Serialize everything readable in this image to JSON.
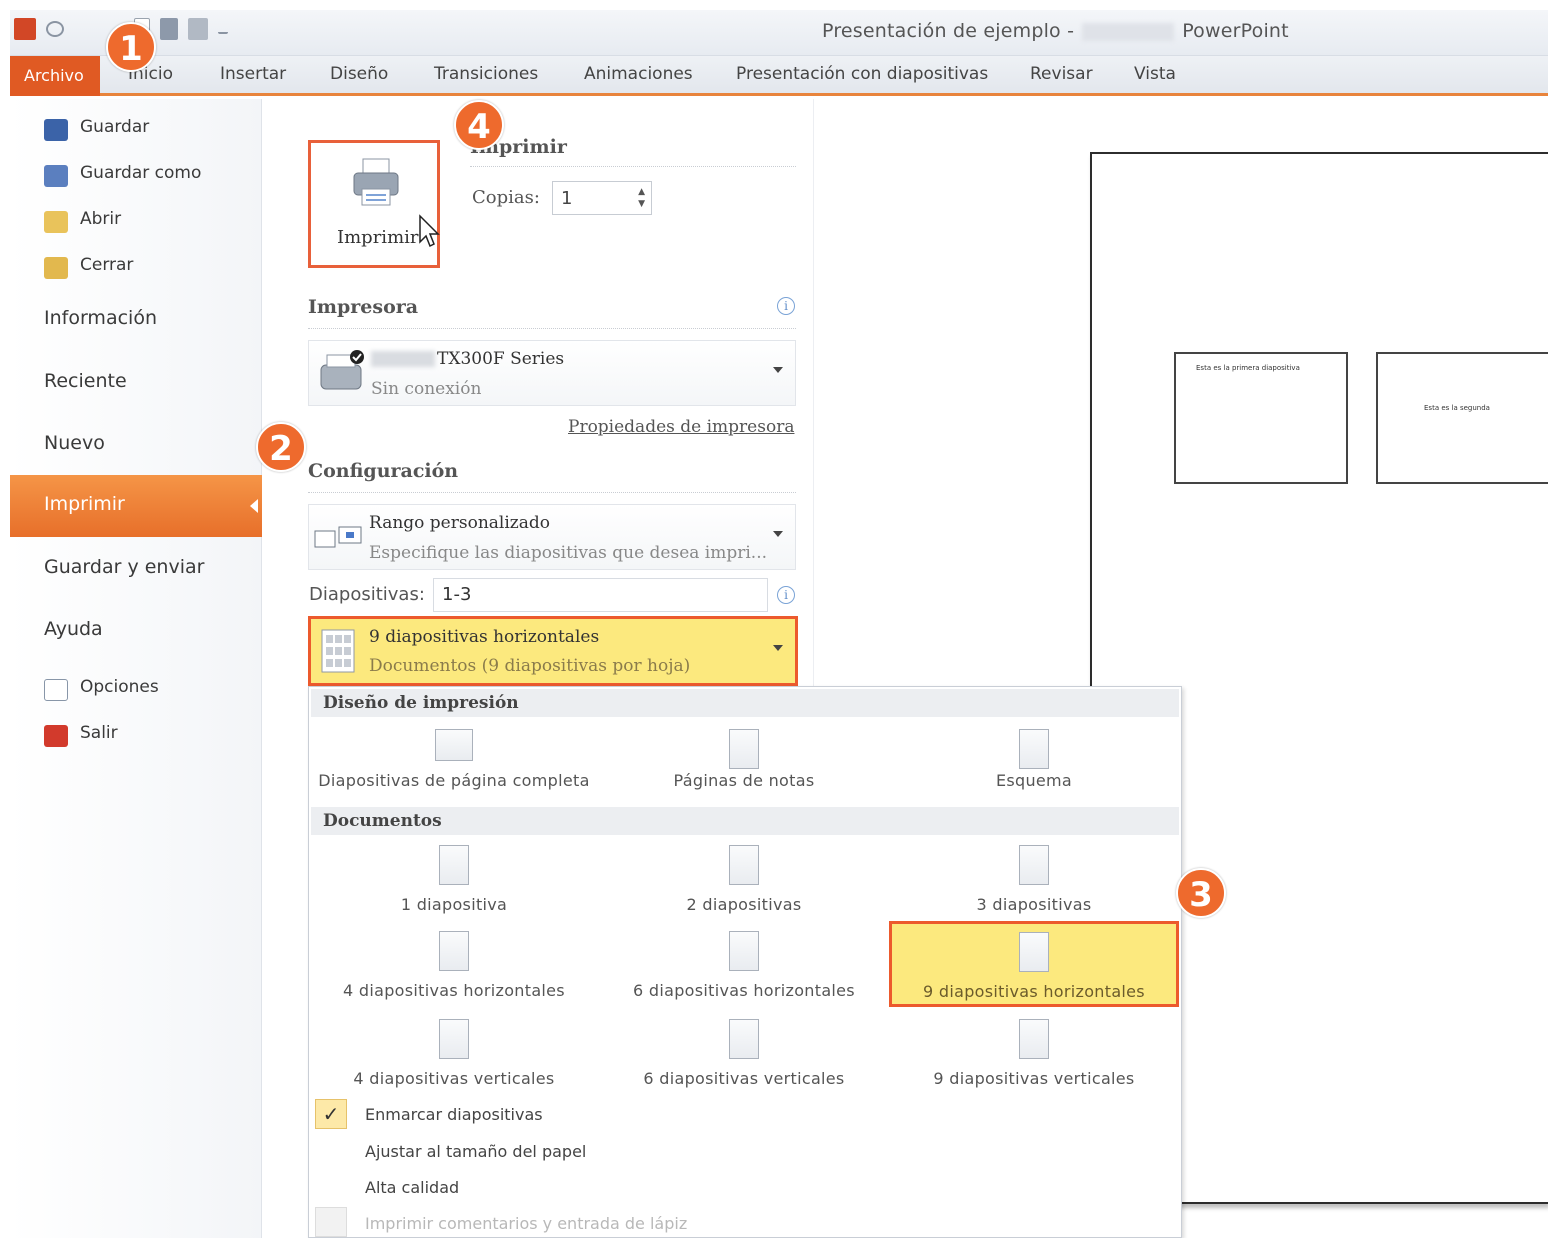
{
  "titlebar": {
    "title_left": "Presentación de ejemplo -",
    "title_right": "PowerPoint"
  },
  "tabs": [
    "Archivo",
    "Inicio",
    "Insertar",
    "Diseño",
    "Transiciones",
    "Animaciones",
    "Presentación con diapositivas",
    "Revisar",
    "Vista"
  ],
  "nav": {
    "items": [
      "Guardar",
      "Guardar como",
      "Abrir",
      "Cerrar",
      "Información",
      "Reciente",
      "Nuevo",
      "Imprimir",
      "Guardar y enviar",
      "Ayuda",
      "Opciones",
      "Salir"
    ]
  },
  "print": {
    "button_label": "Imprimir",
    "heading": "Imprimir",
    "copies_label": "Copias:",
    "copies_value": "1"
  },
  "printer": {
    "heading": "Impresora",
    "name": "TX300F Series",
    "status": "Sin conexión",
    "properties_link": "Propiedades de impresora"
  },
  "config": {
    "heading": "Configuración",
    "range_title": "Rango personalizado",
    "range_desc": "Especifique las diapositivas que desea impri...",
    "slides_label": "Diapositivas:",
    "slides_value": "1-3",
    "layout_title": "9 diapositivas horizontales",
    "layout_desc": "Documentos (9 diapositivas por hoja)"
  },
  "gallery": {
    "section_print_layout": "Diseño de impresión",
    "print_layout_items": [
      "Diapositivas de página completa",
      "Páginas de notas",
      "Esquema"
    ],
    "section_handouts": "Documentos",
    "handout_items": [
      "1 diapositiva",
      "2 diapositivas",
      "3 diapositivas",
      "4 diapositivas horizontales",
      "6 diapositivas horizontales",
      "9 diapositivas horizontales",
      "4 diapositivas verticales",
      "6 diapositivas verticales",
      "9 diapositivas verticales"
    ],
    "options": [
      "Enmarcar diapositivas",
      "Ajustar al tamaño del papel",
      "Alta calidad",
      "Imprimir comentarios y entrada de lápiz"
    ]
  },
  "preview": {
    "thumb1_text": "Esta es la primera diapositiva",
    "thumb2_text": "Esta es la segunda"
  },
  "callouts": [
    "1",
    "2",
    "3",
    "4"
  ],
  "colors": {
    "accent_orange": "#e8603a",
    "highlight_yellow": "#fce97e",
    "file_tab": "#e05a23"
  }
}
